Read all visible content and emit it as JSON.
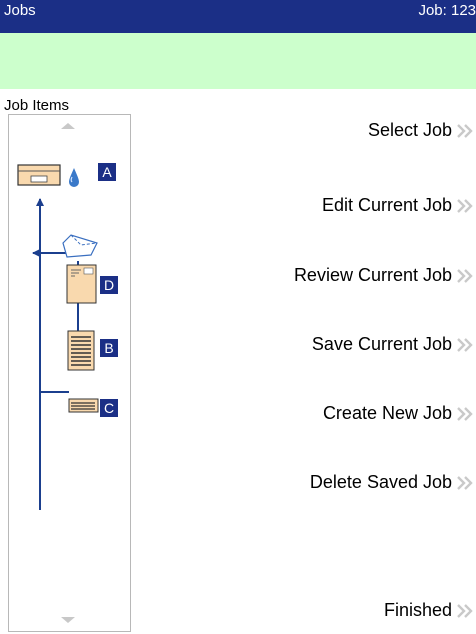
{
  "header": {
    "title": "Jobs",
    "job_label": "Job: 123"
  },
  "panel": {
    "label": "Job Items",
    "badges": [
      "A",
      "D",
      "B",
      "C"
    ]
  },
  "menu": {
    "items": [
      "Select Job",
      "Edit Current Job",
      "Review Current Job",
      "Save Current Job",
      "Create New Job",
      "Delete Saved Job",
      "Finished"
    ]
  },
  "colors": {
    "title_bar": "#1b2f86",
    "banner": "#ccffcc",
    "badge": "#1b2f86",
    "tree_line": "#1b3f8e",
    "item_fill": "#f9d9ae",
    "chevron": "#c9c9c9"
  },
  "icons": [
    "envelope-icon",
    "ink-drop-icon",
    "open-envelope-icon",
    "document-icon",
    "text-sheet-icon",
    "insert-icon",
    "chevron-double-right-icon"
  ]
}
